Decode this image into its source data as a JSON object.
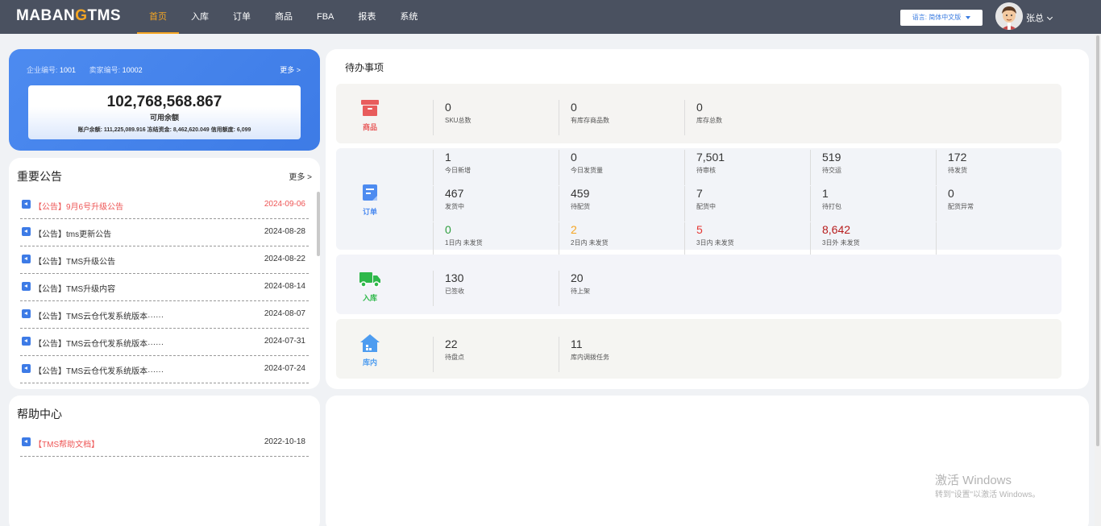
{
  "header": {
    "logo_left": "MABAN",
    "logo_g": "G",
    "logo_right": "TMS",
    "nav": [
      "首页",
      "入库",
      "订单",
      "商品",
      "FBA",
      "报表",
      "系统"
    ],
    "language": "语言: 简体中文版",
    "username": "张总"
  },
  "balance": {
    "company_label": "企业编号:",
    "company_id": "1001",
    "seller_label": "卖家编号:",
    "seller_id": "10002",
    "more": "更多 >",
    "amount": "102,768,568.867",
    "amount_label": "可用余额",
    "detail": "账户余额: 111,225,089.916 冻结资金: 8,462,620.049 信用额度: 6,099"
  },
  "notice": {
    "title": "重要公告",
    "more": "更多 >",
    "items": [
      {
        "text": "【公告】9月6号升级公告",
        "date": "2024-09-06"
      },
      {
        "text": "【公告】tms更新公告",
        "date": "2024-08-28"
      },
      {
        "text": "【公告】TMS升级公告",
        "date": "2024-08-22"
      },
      {
        "text": "【公告】TMS升级内容",
        "date": "2024-08-14"
      },
      {
        "text": "【公告】TMS云仓代发系统版本······",
        "date": "2024-08-07"
      },
      {
        "text": "【公告】TMS云仓代发系统版本······",
        "date": "2024-07-31"
      },
      {
        "text": "【公告】TMS云仓代发系统版本······",
        "date": "2024-07-24"
      }
    ]
  },
  "help": {
    "title": "帮助中心",
    "items": [
      {
        "text": "【TMS帮助文档】",
        "date": "2022-10-18"
      }
    ]
  },
  "todo": {
    "title": "待办事项",
    "product": {
      "label": "商品",
      "color": "#e85c5c",
      "cells": [
        {
          "value": "0",
          "label": "SKU总数"
        },
        {
          "value": "0",
          "label": "有库存商品数"
        },
        {
          "value": "0",
          "label": "库存总数"
        }
      ]
    },
    "order": {
      "label": "订单",
      "color": "#4d8bf0",
      "rows": [
        [
          {
            "value": "1",
            "label": "今日新增"
          },
          {
            "value": "0",
            "label": "今日发货量"
          },
          {
            "value": "7,501",
            "label": "待审核"
          },
          {
            "value": "519",
            "label": "待交运"
          },
          {
            "value": "172",
            "label": "待发货"
          }
        ],
        [
          {
            "value": "467",
            "label": "发货中"
          },
          {
            "value": "459",
            "label": "待配货"
          },
          {
            "value": "7",
            "label": "配货中"
          },
          {
            "value": "1",
            "label": "待打包"
          },
          {
            "value": "0",
            "label": "配货异常"
          }
        ],
        [
          {
            "value": "0",
            "label": "1日内 未发货",
            "color": "#2e9e3e"
          },
          {
            "value": "2",
            "label": "2日内 未发货",
            "color": "#f5a623"
          },
          {
            "value": "5",
            "label": "3日内 未发货",
            "color": "#e53935"
          },
          {
            "value": "8,642",
            "label": "3日外 未发货",
            "color": "#b71c1c"
          }
        ]
      ]
    },
    "inbound": {
      "label": "入库",
      "color": "#2eb84a",
      "cells": [
        {
          "value": "130",
          "label": "已签收"
        },
        {
          "value": "20",
          "label": "待上架"
        }
      ]
    },
    "warehouse": {
      "label": "库内",
      "color": "#4d9cf0",
      "cells": [
        {
          "value": "22",
          "label": "待盘点"
        },
        {
          "value": "11",
          "label": "库内调拨任务"
        }
      ]
    }
  },
  "watermark": {
    "line1": "激活 Windows",
    "line2": "转到\"设置\"以激活 Windows。"
  }
}
